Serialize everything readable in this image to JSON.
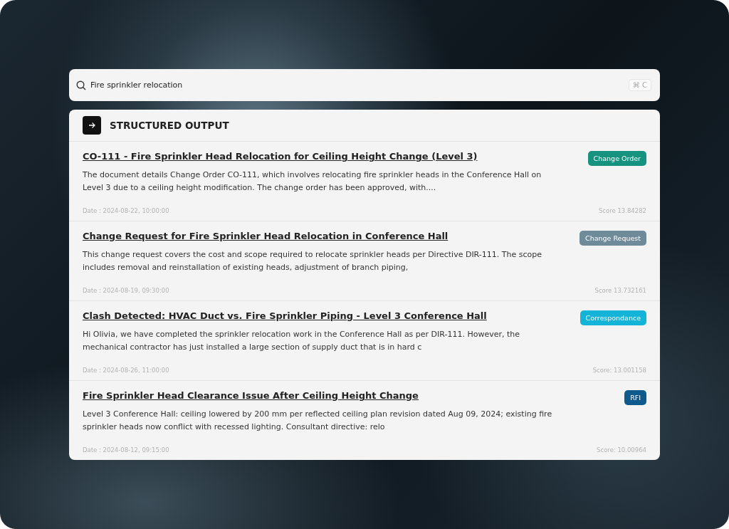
{
  "search": {
    "value": "Fire sprinkler relocation",
    "shortcut": "⌘ C"
  },
  "panel": {
    "title": "STRUCTURED OUTPUT"
  },
  "results": [
    {
      "title": "CO-111 - Fire Sprinkler Head Relocation for Ceiling Height Change (Level 3)",
      "tag": "Change Order",
      "color": "#16937f",
      "summary": "The document details Change Order CO-111, which involves relocating fire sprinkler heads in the Conference Hall on Level 3 due to a ceiling height modification. The change order has been approved, with....",
      "date": "Date : 2024-08-22, 10:00:00",
      "score": "Score 13.84282"
    },
    {
      "title": "Change Request for Fire Sprinkler Head Relocation in Conference Hall",
      "tag": "Change Request",
      "color": "#6f8b99",
      "summary": "This change request covers the cost and scope required to relocate sprinkler heads per Directive DIR-111. The scope includes removal and reinstallation of existing heads, adjustment of branch piping,",
      "date": "Date : 2024-08-19, 09:30:00",
      "score": "Score 13.732161"
    },
    {
      "title": "Clash Detected: HVAC Duct vs. Fire Sprinkler Piping - Level 3 Conference Hall",
      "tag": "Correspondance",
      "color": "#13b4d8",
      "summary": "Hi Olivia, we have completed the sprinkler relocation work in the Conference Hall as per DIR-111. However, the mechanical contractor has just installed a large section of supply duct that is in hard c",
      "date": "Date : 2024-08-26, 11:00:00",
      "score": "Score: 13.001158"
    },
    {
      "title": "Fire Sprinkler Head Clearance Issue After Ceiling Height Change",
      "tag": "RFI",
      "color": "#0f5a8c",
      "summary": "Level 3 Conference Hall: ceiling lowered by 200 mm per reflected ceiling plan revision dated Aug 09, 2024; existing fire sprinkler heads now conflict with recessed lighting. Consultant directive: relo",
      "date": "Date : 2024-08-12, 09:15:00",
      "score": "Score: 10.00964"
    }
  ]
}
